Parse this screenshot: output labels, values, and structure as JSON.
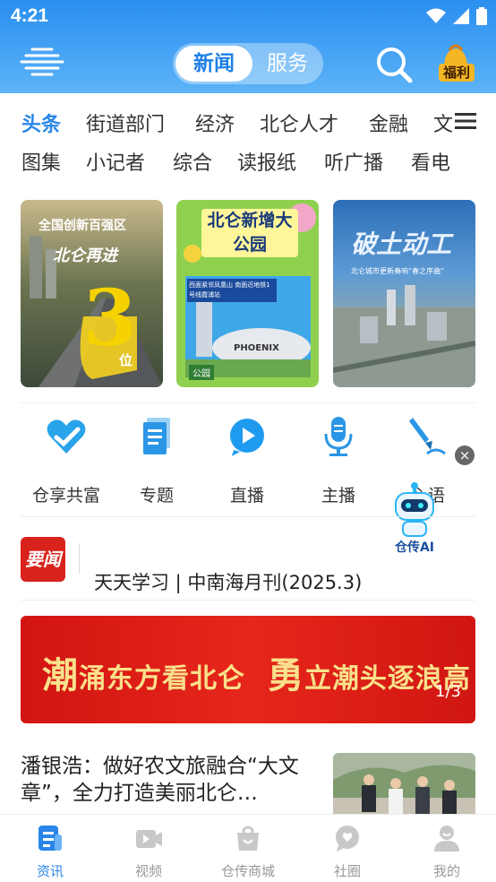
{
  "status_bar": {
    "time": "4:21"
  },
  "header": {
    "segments": [
      "新闻",
      "服务"
    ],
    "fuli_label": "福利",
    "colors": {
      "accent": "#2a86e8",
      "header_top": "#2a8ff0",
      "header_bottom": "#5cb3f7"
    }
  },
  "categories": {
    "row1": [
      "头条",
      "街道部门",
      "经济",
      "北仑人才",
      "金融",
      "文"
    ],
    "row2": [
      "图集",
      "小记者",
      "综合",
      "读报纸",
      "听广播",
      "看电"
    ]
  },
  "cards": [
    {
      "title": "全国创新百强区",
      "subtitle": "北仑再进",
      "big": "3",
      "unit": "位"
    },
    {
      "title": "北仑新增大公园",
      "caption": "西面紧邻凤凰山 南面近地铁1号线霞浦站",
      "tag": "PHOENIX",
      "badge": "公园"
    },
    {
      "title": "破土动工",
      "caption": "北仑城市更新奏响“春之序曲”"
    }
  ],
  "quick_actions": [
    {
      "label": "仓享共富",
      "icon": "heart-check-icon"
    },
    {
      "label": "专题",
      "icon": "document-icon"
    },
    {
      "label": "直播",
      "icon": "live-play-icon"
    },
    {
      "label": "主播",
      "icon": "microphone-icon"
    },
    {
      "label": "心语",
      "icon": "pen-icon"
    }
  ],
  "float_ai": {
    "label": "仓传AI",
    "close": "×"
  },
  "news": {
    "badge": "要闻",
    "headline": "天天学习 | 中南海月刊(2025.3)"
  },
  "banner": {
    "char1": "潮",
    "text1": "涌东方看北仑",
    "char2": "勇",
    "text2": "立潮头逐浪高",
    "page": "1/3"
  },
  "article": {
    "title": "潘银浩：做好农文旅融合“大文章”，全力打造美丽北仑…"
  },
  "tabbar": [
    {
      "label": "资讯",
      "icon": "news-icon",
      "active": true
    },
    {
      "label": "视频",
      "icon": "video-icon"
    },
    {
      "label": "仓传商城",
      "icon": "shopping-bag-icon"
    },
    {
      "label": "社圈",
      "icon": "community-icon"
    },
    {
      "label": "我的",
      "icon": "profile-icon"
    }
  ]
}
